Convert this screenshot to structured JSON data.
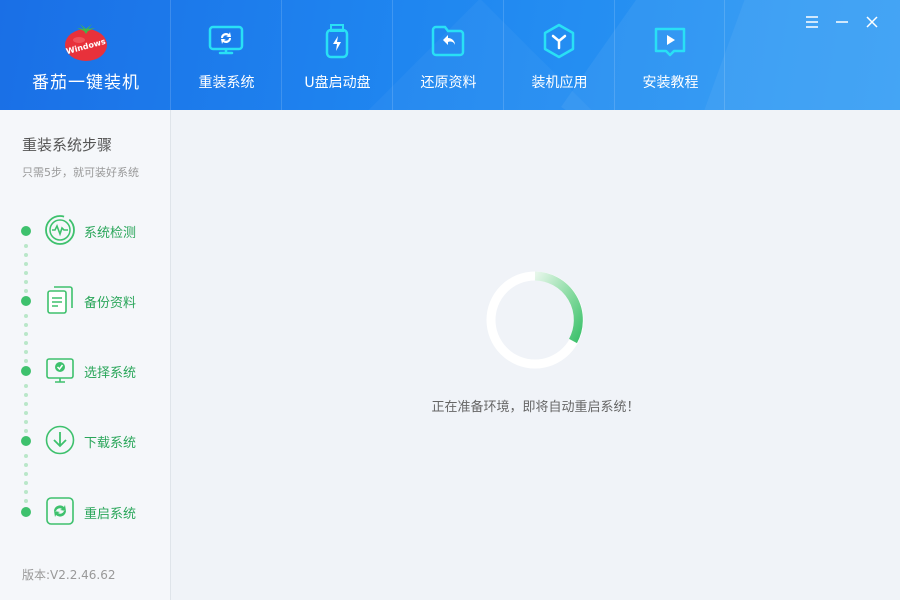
{
  "brand": {
    "name": "番茄一键装机",
    "logo_text": "Windows"
  },
  "nav": {
    "items": [
      {
        "label": "重装系统",
        "icon": "monitor-refresh-icon"
      },
      {
        "label": "U盘启动盘",
        "icon": "usb-drive-icon"
      },
      {
        "label": "还原资料",
        "icon": "folder-restore-icon"
      },
      {
        "label": "装机应用",
        "icon": "apps-hexagon-icon"
      },
      {
        "label": "安装教程",
        "icon": "video-tutorial-icon"
      }
    ]
  },
  "sidebar": {
    "title": "重装系统步骤",
    "subtitle": "只需5步，就可装好系统",
    "steps": [
      {
        "label": "系统检测",
        "icon": "system-check-icon"
      },
      {
        "label": "备份资料",
        "icon": "backup-docs-icon"
      },
      {
        "label": "选择系统",
        "icon": "select-system-icon"
      },
      {
        "label": "下载系统",
        "icon": "download-icon"
      },
      {
        "label": "重启系统",
        "icon": "restart-icon"
      }
    ],
    "version": "版本:V2.2.46.62"
  },
  "main": {
    "status_text": "正在准备环境，即将自动重启系统！"
  },
  "colors": {
    "header_start": "#1a6fe6",
    "header_end": "#2e9cf5",
    "accent_green": "#3ec16d",
    "icon_cyan": "#29e0f5"
  }
}
